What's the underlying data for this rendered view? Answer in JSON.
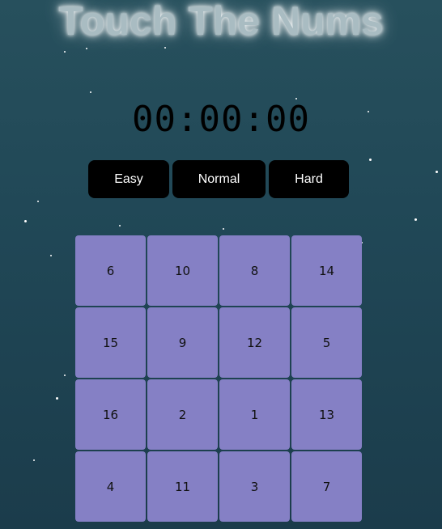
{
  "title": "Touch The Nums",
  "timer": "00:00:00",
  "modes": {
    "easy": "Easy",
    "normal": "Normal",
    "hard": "Hard"
  },
  "grid": [
    "6",
    "10",
    "8",
    "14",
    "15",
    "9",
    "12",
    "5",
    "16",
    "2",
    "1",
    "13",
    "4",
    "11",
    "3",
    "7"
  ],
  "colors": {
    "background": "#204756",
    "tile": "#8580c5",
    "button": "#000000"
  }
}
